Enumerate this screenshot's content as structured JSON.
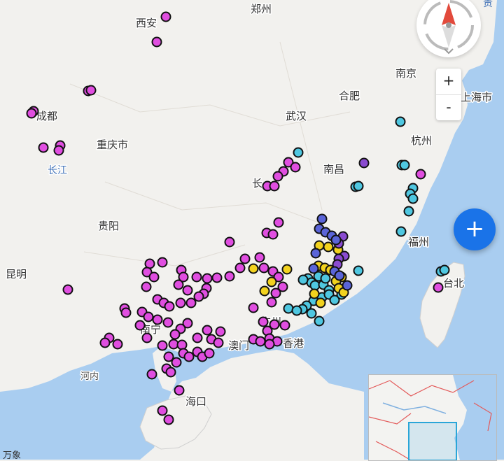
{
  "map": {
    "city_labels": [
      {
        "text": "郑州"
      },
      {
        "text": "西安"
      },
      {
        "text": "南京"
      },
      {
        "text": "合肥"
      },
      {
        "text": "上海市"
      },
      {
        "text": "成都"
      },
      {
        "text": "武汉"
      },
      {
        "text": "杭州"
      },
      {
        "text": "重庆市"
      },
      {
        "text": "南昌"
      },
      {
        "text": "长"
      },
      {
        "text": "贵阳"
      },
      {
        "text": "福州"
      },
      {
        "text": "昆明"
      },
      {
        "text": "台北"
      },
      {
        "text": "南宁"
      },
      {
        "text": "广州"
      },
      {
        "text": "澳门"
      },
      {
        "text": "香港"
      },
      {
        "text": "河内"
      },
      {
        "text": "海口"
      }
    ],
    "river_labels": [
      {
        "text": "长江"
      }
    ],
    "colors": {
      "magenta": "#e04ee0",
      "cyan": "#4fc7e0",
      "yellow": "#f2d21e",
      "purple": "#8a4bd0",
      "blue": "#5a64d8",
      "water": "#a9cdf0",
      "land": "#f2f1ee"
    }
  },
  "compass": {
    "icon": "compass-icon"
  },
  "zoom": {
    "in_label": "+",
    "out_label": "-"
  },
  "fab": {
    "label": "+"
  },
  "attribution": {
    "text": "万象"
  },
  "corner_text": {
    "text": "贵"
  }
}
